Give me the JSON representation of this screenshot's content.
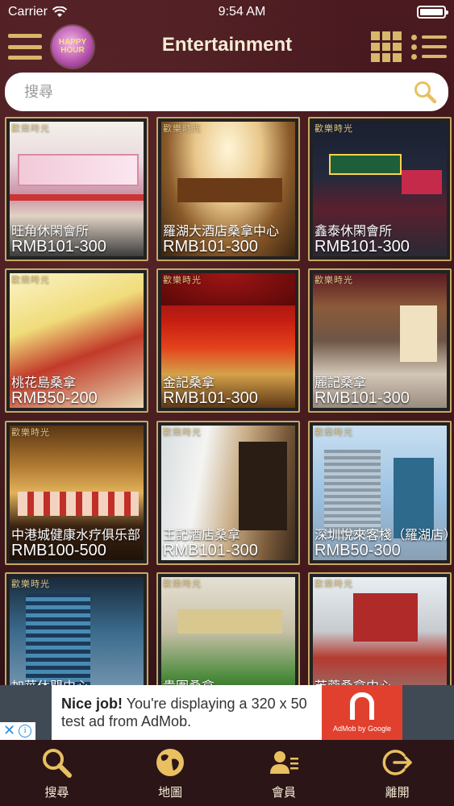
{
  "status_bar": {
    "carrier": "Carrier",
    "time": "9:54 AM"
  },
  "nav": {
    "title": "Entertainment",
    "logo_text": "HAPPY HOUR",
    "accent_color": "#d7b76a"
  },
  "search": {
    "placeholder": "搜尋"
  },
  "watermark": "歡樂時光",
  "listings": [
    {
      "name": "旺角休閑會所",
      "price": "RMB101-300"
    },
    {
      "name": "羅湖大酒店桑拿中心",
      "price": "RMB101-300"
    },
    {
      "name": "鑫泰休閑會所",
      "price": "RMB101-300"
    },
    {
      "name": "桃花島桑拿",
      "price": "RMB50-200"
    },
    {
      "name": "金記桑拿",
      "price": "RMB101-300"
    },
    {
      "name": "麗記桑拿",
      "price": "RMB101-300"
    },
    {
      "name": "中港城健康水疗俱乐部",
      "price": "RMB100-500"
    },
    {
      "name": "王記酒店桑拿",
      "price": "RMB101-300"
    },
    {
      "name": "深圳悅來客棧（羅湖店）",
      "price": "RMB50-300"
    },
    {
      "name": "加華休閒中心",
      "price": ""
    },
    {
      "name": "貴圍桑拿",
      "price": ""
    },
    {
      "name": "芙蓉桑拿中心",
      "price": ""
    }
  ],
  "ad": {
    "headline": "Nice job!",
    "body": " You're displaying a 320 x 50 test ad from AdMob.",
    "brand": "AdMob by Google",
    "close": "✕",
    "info": "i"
  },
  "tabs": [
    {
      "label": "搜尋",
      "icon": "search-icon"
    },
    {
      "label": "地圖",
      "icon": "globe-icon"
    },
    {
      "label": "會員",
      "icon": "member-icon"
    },
    {
      "label": "離開",
      "icon": "logout-icon"
    }
  ]
}
